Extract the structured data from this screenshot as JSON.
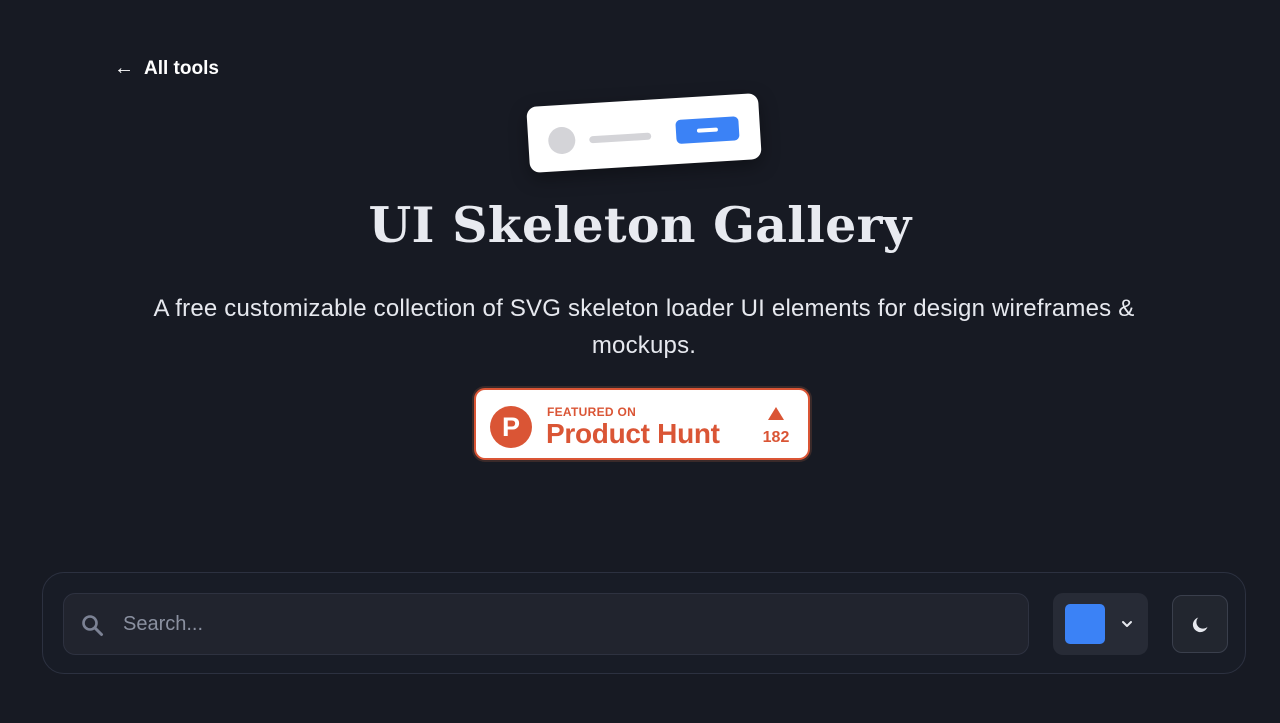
{
  "nav": {
    "back_arrow": "←",
    "back_label": "All tools",
    "icon": "arrow-left-icon"
  },
  "hero": {
    "title": "UI Skeleton Gallery",
    "subtitle": "A free customizable collection of SVG skeleton loader UI elements for design wireframes & mockups."
  },
  "product_hunt_badge": {
    "logo_letter": "P",
    "featured_label": "FEATURED ON",
    "name": "Product Hunt",
    "upvotes": "182",
    "color": "#da5535"
  },
  "toolbar": {
    "search": {
      "placeholder": "Search...",
      "value": "",
      "icon": "search-icon"
    },
    "color_picker": {
      "selected_color": "#3b82f6",
      "icon": "chevron-down-icon"
    },
    "theme_toggle": {
      "icon": "moon-icon"
    }
  },
  "colors": {
    "background": "#171a23",
    "accent": "#3b82f6",
    "brand": "#da5535"
  }
}
